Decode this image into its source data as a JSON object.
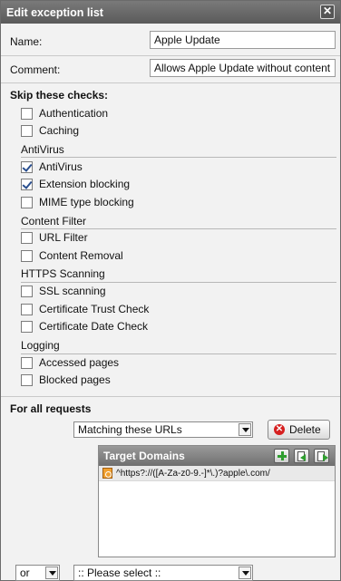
{
  "window": {
    "title": "Edit exception list",
    "close_symbol": "✕"
  },
  "form": {
    "name_label": "Name:",
    "name_value": "Apple Update",
    "comment_label": "Comment:",
    "comment_value": "Allows Apple Update without content"
  },
  "skip": {
    "title": "Skip these checks:",
    "general": [
      {
        "label": "Authentication",
        "checked": false
      },
      {
        "label": "Caching",
        "checked": false
      }
    ],
    "antivirus": {
      "title": "AntiVirus",
      "items": [
        {
          "label": "AntiVirus",
          "checked": true
        },
        {
          "label": "Extension blocking",
          "checked": true
        },
        {
          "label": "MIME type blocking",
          "checked": false
        }
      ]
    },
    "content_filter": {
      "title": "Content Filter",
      "items": [
        {
          "label": "URL Filter",
          "checked": false
        },
        {
          "label": "Content Removal",
          "checked": false
        }
      ]
    },
    "https": {
      "title": "HTTPS Scanning",
      "items": [
        {
          "label": "SSL scanning",
          "checked": false
        },
        {
          "label": "Certificate Trust Check",
          "checked": false
        },
        {
          "label": "Certificate Date Check",
          "checked": false
        }
      ]
    },
    "logging": {
      "title": "Logging",
      "items": [
        {
          "label": "Accessed pages",
          "checked": false
        },
        {
          "label": "Blocked pages",
          "checked": false
        }
      ]
    }
  },
  "requests": {
    "title": "For all requests",
    "match_select": "Matching these URLs",
    "delete_label": "Delete",
    "domains_title": "Target Domains",
    "domains": [
      "^https?://([A-Za-z0-9.-]*\\.)?apple\\.com/"
    ],
    "or_select": "or",
    "please_select": ":: Please select ::"
  },
  "colors": {
    "check_mark": "#2a4f8f",
    "add_icon": "#2f9e2f",
    "delete_icon": "#d61f1f",
    "regex_icon": "#f0a030"
  }
}
